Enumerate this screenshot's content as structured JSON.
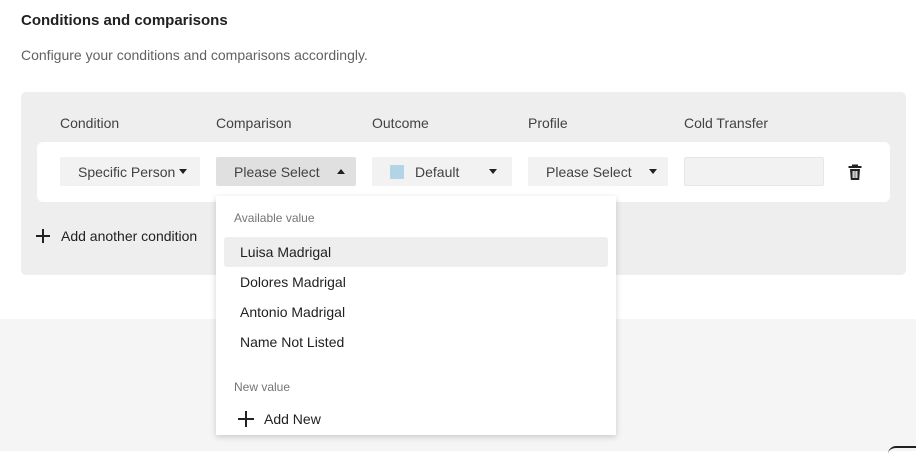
{
  "section": {
    "title": "Conditions and comparisons",
    "description": "Configure your conditions and comparisons accordingly."
  },
  "columns": [
    "Condition",
    "Comparison",
    "Outcome",
    "Profile",
    "Cold Transfer"
  ],
  "row": {
    "condition_value": "Specific Person",
    "comparison_value": "Please Select",
    "outcome_value": "Default",
    "outcome_swatch_color": "#b3d4e6",
    "profile_value": "Please Select",
    "cold_transfer_value": ""
  },
  "add_condition_label": "Add another condition",
  "dropdown": {
    "available_label": "Available value",
    "items": [
      "Luisa Madrigal",
      "Dolores Madrigal",
      "Antonio Madrigal",
      "Name Not Listed"
    ],
    "new_label": "New value",
    "add_new_label": "Add New"
  },
  "icons": {
    "trash": "trash-icon",
    "plus": "plus-icon",
    "caret_down": "caret-down-icon",
    "caret_up": "caret-up-icon"
  }
}
